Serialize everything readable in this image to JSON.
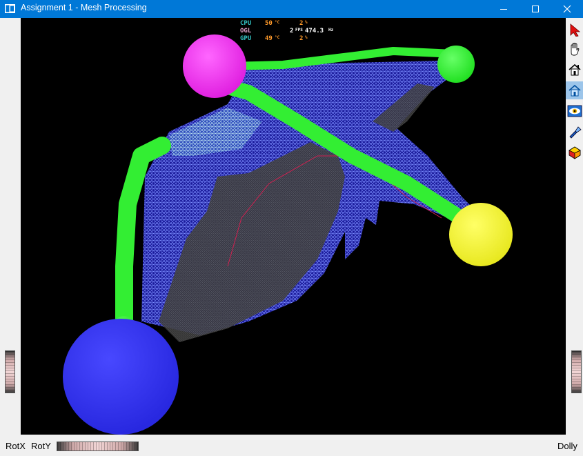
{
  "window": {
    "title": "Assignment 1 - Mesh Processing",
    "controls": [
      "minimize",
      "maximize",
      "close"
    ]
  },
  "toolbar": {
    "tools": [
      {
        "name": "select-arrow-icon",
        "active": false
      },
      {
        "name": "pan-hand-icon",
        "active": false
      },
      {
        "name": "home-icon",
        "active": false
      },
      {
        "name": "set-home-icon",
        "active": true
      },
      {
        "name": "view-all-eye-icon",
        "active": false
      },
      {
        "name": "seek-flashlight-icon",
        "active": false
      },
      {
        "name": "projection-cube-icon",
        "active": false
      }
    ]
  },
  "hud": {
    "cpu": {
      "label": "CPU",
      "temp": "50",
      "temp_unit": "°C",
      "load": "2",
      "load_unit": "%"
    },
    "ogl": {
      "label": "OGL",
      "value": "2",
      "fps_label": "FPS",
      "fps": "474.3",
      "fps_unit": "Hz"
    },
    "gpu": {
      "label": "GPU",
      "temp": "49",
      "temp_unit": "°C",
      "load": "2",
      "load_unit": "%"
    },
    "colors": {
      "cpu": "#33c3c3",
      "ogl": "#e0a0c8",
      "gpu": "#33c3c3",
      "values": "#ff9a2a",
      "white": "#ffffff"
    }
  },
  "bottom": {
    "rotx": "RotX",
    "roty": "RotY",
    "dolly": "Dolly"
  },
  "scene": {
    "background": "#000000",
    "sphere_colors": {
      "magenta": "#ff33ff",
      "yellow": "#ffff33",
      "blue": "#3333ff",
      "green": "#33ff33"
    }
  }
}
